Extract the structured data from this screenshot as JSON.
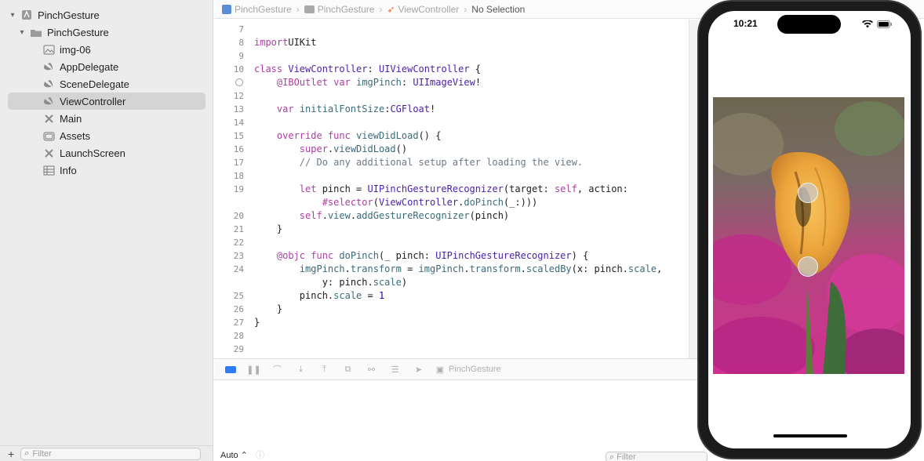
{
  "sidebar": {
    "items": [
      {
        "label": "PinchGesture",
        "icon": "project-icon",
        "chevron": "⌄"
      },
      {
        "label": "PinchGesture",
        "icon": "folder-icon",
        "chevron": "⌄"
      },
      {
        "label": "img-06",
        "icon": "image-icon"
      },
      {
        "label": "AppDelegate",
        "icon": "swift-icon"
      },
      {
        "label": "SceneDelegate",
        "icon": "swift-icon"
      },
      {
        "label": "ViewController",
        "icon": "swift-icon",
        "selected": true
      },
      {
        "label": "Main",
        "icon": "storyboard-icon"
      },
      {
        "label": "Assets",
        "icon": "assets-icon"
      },
      {
        "label": "LaunchScreen",
        "icon": "storyboard-icon"
      },
      {
        "label": "Info",
        "icon": "plist-icon"
      }
    ],
    "filter_placeholder": "Filter"
  },
  "breadcrumb": {
    "items": [
      "PinchGesture",
      "PinchGesture",
      "ViewController",
      "No Selection"
    ]
  },
  "editor": {
    "lines": [
      {
        "n": "7",
        "tokens": []
      },
      {
        "n": "8",
        "tokens": [
          [
            "kw",
            "import"
          ],
          [
            "",
            "UIKit"
          ]
        ]
      },
      {
        "n": "9",
        "tokens": []
      },
      {
        "n": "10",
        "tokens": [
          [
            "kw",
            "class"
          ],
          [
            "",
            ""
          ],
          [
            "ty",
            "ViewController"
          ],
          [
            "",
            ": "
          ],
          [
            "ty",
            "UIViewController"
          ],
          [
            "",
            " {"
          ]
        ]
      },
      {
        "n": "",
        "outlet": true,
        "tokens": [
          [
            "",
            "    "
          ],
          [
            "kw",
            "@IBOutlet"
          ],
          [
            "",
            " "
          ],
          [
            "kw",
            "var"
          ],
          [
            "",
            " "
          ],
          [
            "fn",
            "imgPinch"
          ],
          [
            "",
            ": "
          ],
          [
            "ty",
            "UIImageView"
          ],
          [
            "",
            "!"
          ]
        ]
      },
      {
        "n": "12",
        "tokens": []
      },
      {
        "n": "13",
        "tokens": [
          [
            "",
            "    "
          ],
          [
            "kw",
            "var"
          ],
          [
            "",
            " "
          ],
          [
            "fn",
            "initialFontSize"
          ],
          [
            "",
            ":"
          ],
          [
            "ty",
            "CGFloat"
          ],
          [
            "",
            "!"
          ]
        ]
      },
      {
        "n": "14",
        "tokens": []
      },
      {
        "n": "15",
        "tokens": [
          [
            "",
            "    "
          ],
          [
            "kw",
            "override"
          ],
          [
            "",
            " "
          ],
          [
            "kw",
            "func"
          ],
          [
            "",
            " "
          ],
          [
            "fn",
            "viewDidLoad"
          ],
          [
            "",
            "() {"
          ]
        ]
      },
      {
        "n": "16",
        "tokens": [
          [
            "",
            "        "
          ],
          [
            "kw",
            "super"
          ],
          [
            "",
            "."
          ],
          [
            "fn",
            "viewDidLoad"
          ],
          [
            "",
            "()"
          ]
        ]
      },
      {
        "n": "17",
        "tokens": [
          [
            "",
            "        "
          ],
          [
            "cm",
            "// Do any additional setup after loading the view."
          ]
        ]
      },
      {
        "n": "18",
        "tokens": []
      },
      {
        "n": "19",
        "tokens": [
          [
            "",
            "        "
          ],
          [
            "kw",
            "let"
          ],
          [
            "",
            " pinch = "
          ],
          [
            "ty",
            "UIPinchGestureRecognizer"
          ],
          [
            "",
            "(target: "
          ],
          [
            "kw",
            "self"
          ],
          [
            "",
            ", action:"
          ]
        ]
      },
      {
        "n": "",
        "tokens": [
          [
            "",
            "            "
          ],
          [
            "kw",
            "#selector"
          ],
          [
            "",
            "("
          ],
          [
            "ty",
            "ViewController"
          ],
          [
            "",
            "."
          ],
          [
            "fn",
            "doPinch"
          ],
          [
            "",
            "(_:)))"
          ]
        ]
      },
      {
        "n": "20",
        "tokens": [
          [
            "",
            "        "
          ],
          [
            "kw",
            "self"
          ],
          [
            "",
            "."
          ],
          [
            "fn",
            "view"
          ],
          [
            "",
            "."
          ],
          [
            "fn",
            "addGestureRecognizer"
          ],
          [
            "",
            "(pinch)"
          ]
        ]
      },
      {
        "n": "21",
        "tokens": [
          [
            "",
            "    }"
          ]
        ]
      },
      {
        "n": "22",
        "tokens": []
      },
      {
        "n": "23",
        "tokens": [
          [
            "",
            "    "
          ],
          [
            "kw",
            "@objc"
          ],
          [
            "",
            " "
          ],
          [
            "kw",
            "func"
          ],
          [
            "",
            " "
          ],
          [
            "fn",
            "doPinch"
          ],
          [
            "",
            "(_ pinch: "
          ],
          [
            "ty",
            "UIPinchGestureRecognizer"
          ],
          [
            "",
            ") {"
          ]
        ]
      },
      {
        "n": "24",
        "tokens": [
          [
            "",
            "        "
          ],
          [
            "fn",
            "imgPinch"
          ],
          [
            "",
            "."
          ],
          [
            "fn",
            "transform"
          ],
          [
            "",
            " = "
          ],
          [
            "fn",
            "imgPinch"
          ],
          [
            "",
            "."
          ],
          [
            "fn",
            "transform"
          ],
          [
            "",
            "."
          ],
          [
            "fn",
            "scaledBy"
          ],
          [
            "",
            "(x: pinch."
          ],
          [
            "fn",
            "scale"
          ],
          [
            "",
            ","
          ]
        ]
      },
      {
        "n": "",
        "tokens": [
          [
            "",
            "            y: pinch."
          ],
          [
            "fn",
            "scale"
          ],
          [
            "",
            ")"
          ]
        ]
      },
      {
        "n": "25",
        "tokens": [
          [
            "",
            "        pinch."
          ],
          [
            "fn",
            "scale"
          ],
          [
            "",
            " = "
          ],
          [
            "nm",
            "1"
          ]
        ]
      },
      {
        "n": "26",
        "tokens": [
          [
            "",
            "    }"
          ]
        ]
      },
      {
        "n": "27",
        "tokens": [
          [
            "",
            "}"
          ]
        ]
      },
      {
        "n": "28",
        "tokens": []
      },
      {
        "n": "29",
        "tokens": []
      }
    ]
  },
  "debugbar": {
    "target_label": "PinchGesture"
  },
  "console": {
    "mode_label": "Auto ⌃",
    "filter_placeholder": "Filter"
  },
  "simulator": {
    "time": "10:21"
  }
}
